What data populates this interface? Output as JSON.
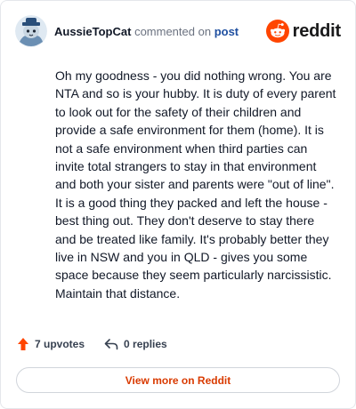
{
  "header": {
    "author": "AussieTopCat",
    "action_text": "commented on",
    "post_link": "post",
    "brand_name": "reddit",
    "brand_color": "#ff4500"
  },
  "comment": {
    "text": "Oh my goodness - you did nothing wrong. You are NTA and so is your hubby. It is duty of every parent to look out for the safety of their children and provide a safe environment for them (home). It is not a safe environment when third parties can invite total strangers to stay in that environment and both your sister and parents were \"out of line\". It is a good thing they packed and left the house - best thing out. They don't deserve to stay there and be treated like family. It's probably better they live in NSW and you in QLD - gives you some space because they seem particularly narcissistic. Maintain that distance."
  },
  "actions": {
    "upvotes": "7 upvotes",
    "replies": "0 replies",
    "upvote_icon": "upvote-arrow-icon",
    "reply_icon": "reply-arrow-icon",
    "upvote_color": "#ff4500"
  },
  "footer": {
    "view_more_label": "View more on Reddit",
    "view_more_color": "#d93a00"
  }
}
